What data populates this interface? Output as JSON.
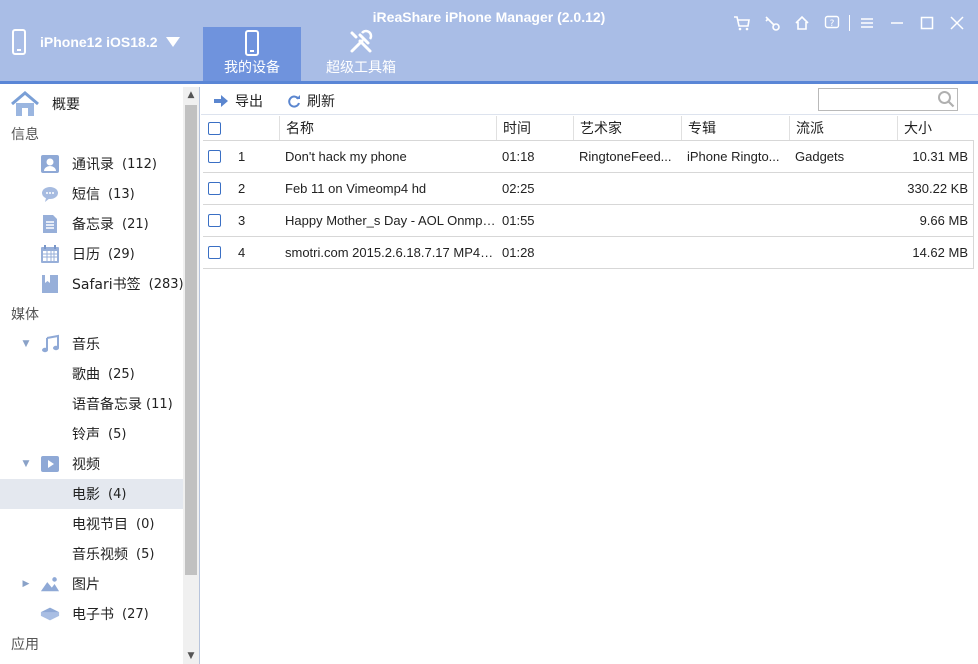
{
  "app": {
    "title": "iReaShare iPhone Manager (2.0.12)"
  },
  "device": {
    "name": "iPhone12 iOS18.2"
  },
  "nav": {
    "tabs": [
      {
        "label": "我的设备",
        "icon": "phone-icon",
        "active": true
      },
      {
        "label": "超级工具箱",
        "icon": "tools-icon",
        "active": false
      }
    ]
  },
  "window_controls": [
    "cart-icon",
    "key-icon",
    "home-icon",
    "help-icon",
    "menu-icon",
    "minimize-icon",
    "maximize-icon",
    "close-icon"
  ],
  "sidebar": {
    "overview": "概要",
    "sections": {
      "info": "信息",
      "media": "媒体",
      "apps": "应用"
    },
    "info_items": [
      {
        "label": "通讯录",
        "count": "(112)",
        "icon": "contacts-icon"
      },
      {
        "label": "短信",
        "count": "(13)",
        "icon": "message-icon"
      },
      {
        "label": "备忘录",
        "count": "(21)",
        "icon": "notes-icon"
      },
      {
        "label": "日历",
        "count": "(29)",
        "icon": "calendar-icon"
      },
      {
        "label": "Safari书签",
        "count": "(283)",
        "icon": "bookmark-icon"
      }
    ],
    "music": {
      "label": "音乐",
      "icon": "music-icon"
    },
    "music_items": [
      {
        "label": "歌曲",
        "count": "(25)"
      },
      {
        "label": "语音备忘录",
        "count": "(11)"
      },
      {
        "label": "铃声",
        "count": "(5)"
      }
    ],
    "video": {
      "label": "视频",
      "icon": "video-icon"
    },
    "video_items": [
      {
        "label": "电影",
        "count": "(4)",
        "selected": true
      },
      {
        "label": "电视节目",
        "count": "(0)"
      },
      {
        "label": "音乐视频",
        "count": "(5)"
      }
    ],
    "photos": {
      "label": "图片",
      "icon": "photo-icon"
    },
    "ebooks": {
      "label": "电子书",
      "count": "(27)",
      "icon": "ebook-icon"
    }
  },
  "toolbar": {
    "export_label": "导出",
    "refresh_label": "刷新",
    "search_placeholder": ""
  },
  "table": {
    "columns": [
      "名称",
      "时间",
      "艺术家",
      "专辑",
      "流派",
      "大小"
    ],
    "rows": [
      {
        "num": "1",
        "name": "Don't hack my phone",
        "time": "01:18",
        "artist": "RingtoneFeed...",
        "album": "iPhone Ringto...",
        "genre": "Gadgets",
        "size": "10.31 MB"
      },
      {
        "num": "2",
        "name": "Feb 11 on Vimeomp4 hd",
        "time": "02:25",
        "artist": "",
        "album": "",
        "genre": "",
        "size": "330.22 KB"
      },
      {
        "num": "3",
        "name": "Happy Mother_s Day - AOL Onmp4...",
        "time": "01:55",
        "artist": "",
        "album": "",
        "genre": "",
        "size": "9.66 MB"
      },
      {
        "num": "4",
        "name": "smotri.com 2015.2.6.18.7.17 MP4 f...",
        "time": "01:28",
        "artist": "",
        "album": "",
        "genre": "",
        "size": "14.62 MB"
      }
    ]
  },
  "colors": {
    "header": "#a9bde6",
    "active_tab": "#6f93dd",
    "accent": "#3a6fc4",
    "selected_row": "#e4e8ef"
  }
}
